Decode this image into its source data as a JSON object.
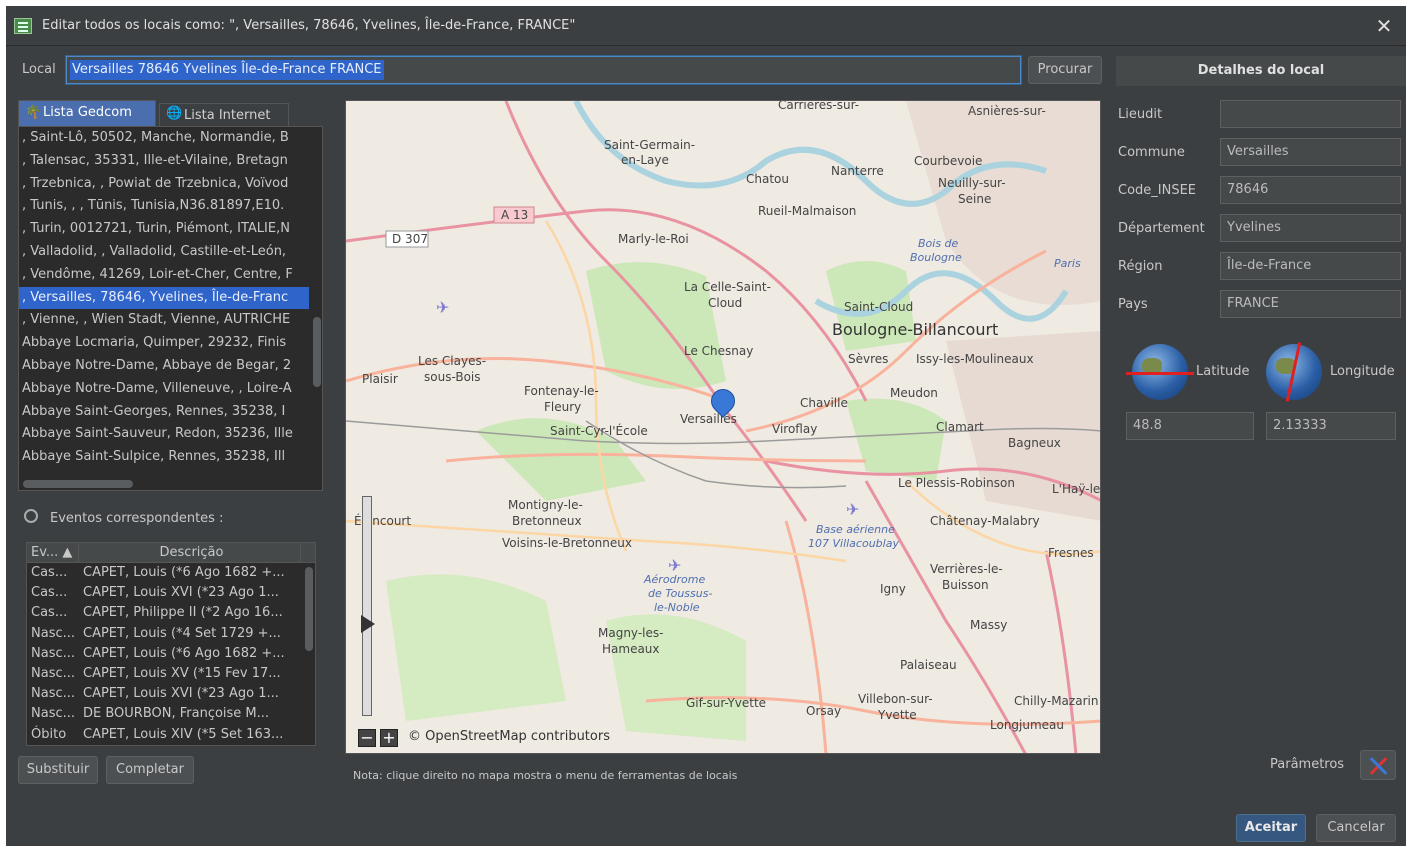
{
  "window": {
    "title": "Editar todos os locais como: \", Versailles, 78646, Yvelines, Île-de-France, FRANCE\""
  },
  "local": {
    "label": "Local",
    "value": "Versailles 78646 Yvelines Île-de-France FRANCE",
    "search_button": "Procurar"
  },
  "tabs": [
    {
      "label": "Lista Gedcom",
      "icon": "palm-tree-icon",
      "active": true
    },
    {
      "label": "Lista Internet",
      "icon": "globe-icon",
      "active": false
    }
  ],
  "places": [
    ", Saint-Lô, 50502, Manche, Normandie, B",
    ", Talensac, 35331, Ille-et-Vilaine, Bretagn",
    ", Trzebnica, , Powiat de Trzebnica, Voïvod",
    ", Tunis, , , Tūnis, Tunisia,N36.81897,E10.",
    ", Turin, 0012721, Turin, Piémont, ITALIE,N",
    ", Valladolid, , Valladolid, Castille-et-León,",
    ", Vendôme, 41269, Loir-et-Cher, Centre, F",
    ", Versailles, 78646, Yvelines, Île-de-Franc",
    ", Vienne, , Wien Stadt, Vienne, AUTRICHE",
    "Abbaye Locmaria, Quimper, 29232, Finis",
    "Abbaye Notre-Dame, Abbaye de Begar, 2",
    "Abbaye Notre-Dame, Villeneuve, , Loire-A",
    "Abbaye Saint-Georges, Rennes, 35238, I",
    "Abbaye Saint-Sauveur, Redon, 35236, Ille",
    "Abbaye Saint-Sulpice, Rennes, 35238, Ill"
  ],
  "selected_place_index": 7,
  "events": {
    "label": "Eventos correspondentes :",
    "columns": [
      "Ev... ▲",
      "Descrição"
    ],
    "rows": [
      [
        "Cas...",
        "CAPET, Louis (*6 Ago 1682 +..."
      ],
      [
        "Cas...",
        "CAPET, Louis XVI (*23 Ago 1..."
      ],
      [
        "Cas...",
        "CAPET, Philippe II (*2 Ago 16..."
      ],
      [
        "Nasc...",
        "CAPET, Louis (*4 Set 1729 +..."
      ],
      [
        "Nasc...",
        "CAPET, Louis (*6 Ago 1682 +..."
      ],
      [
        "Nasc...",
        "CAPET, Louis XV (*15 Fev 17..."
      ],
      [
        "Nasc...",
        "CAPET, Louis XVI (*23 Ago 1..."
      ],
      [
        "Nasc...",
        "DE BOURBON, Françoise M..."
      ],
      [
        "Óbito",
        "CAPET, Louis XIV (*5 Set 163..."
      ]
    ]
  },
  "buttons": {
    "replace": "Substituir",
    "complete": "Completar",
    "accept": "Aceitar",
    "cancel": "Cancelar",
    "parameters": "Parâmetros"
  },
  "map": {
    "attribution": "© OpenStreetMap contributors",
    "note": "Nota: clique direito no mapa mostra o menu de ferramentas de locais",
    "labels": [
      "Saint-Germain-",
      "en-Laye",
      "Chatou",
      "Nanterre",
      "Courbevoie",
      "Neuilly-sur-",
      "Seine",
      "Rueil-Malmaison",
      "Marly-le-Roi",
      "La Celle-Saint-",
      "Cloud",
      "Saint-Cloud",
      "Boulogne-Billancourt",
      "Le Chesnay",
      "Sèvres",
      "Issy-les-Moulineaux",
      "Les Clayes-",
      "sous-Bois",
      "Plaisir",
      "Fontenay-le-",
      "Fleury",
      "Versailles",
      "Chaville",
      "Meudon",
      "Saint-Cyr-l'École",
      "Viroflay",
      "Clamart",
      "Bagneux",
      "Le Plessis-Robinson",
      "L'Haÿ-le",
      "Montigny-le-",
      "Bretonneux",
      "Élancourt",
      "Voisins-le-Bretonneux",
      "Châtenay-Malabry",
      "Verrières-le-",
      "Buisson",
      "Igny",
      "Fresnes",
      "Magny-les-",
      "Hameaux",
      "Massy",
      "Palaiseau",
      "Gif-sur-Yvette",
      "Orsay",
      "Villebon-sur-",
      "Yvette",
      "Chilly-Mazarin",
      "Longjumeau",
      "Carrières-sur-",
      "Asnières-sur-",
      "A 13",
      "D 307",
      "Bois de",
      "Boulogne",
      "Paris",
      "Base aérienne",
      "107 Villacoublay",
      "Aérodrome",
      "de Toussus-",
      "le-Noble"
    ]
  },
  "details": {
    "header": "Detalhes do local",
    "fields": [
      {
        "label": "Lieudit",
        "value": ""
      },
      {
        "label": "Commune",
        "value": "Versailles"
      },
      {
        "label": "Code_INSEE",
        "value": "78646"
      },
      {
        "label": "Département",
        "value": "Yvelines"
      },
      {
        "label": "Région",
        "value": "Île-de-France"
      },
      {
        "label": "Pays",
        "value": "FRANCE"
      }
    ],
    "latitude_label": "Latitude",
    "longitude_label": "Longitude",
    "latitude": "48.8",
    "longitude": "2.13333"
  },
  "colors": {
    "background": "#3c3f41",
    "selection": "#2f65ca",
    "accent": "#365880"
  }
}
